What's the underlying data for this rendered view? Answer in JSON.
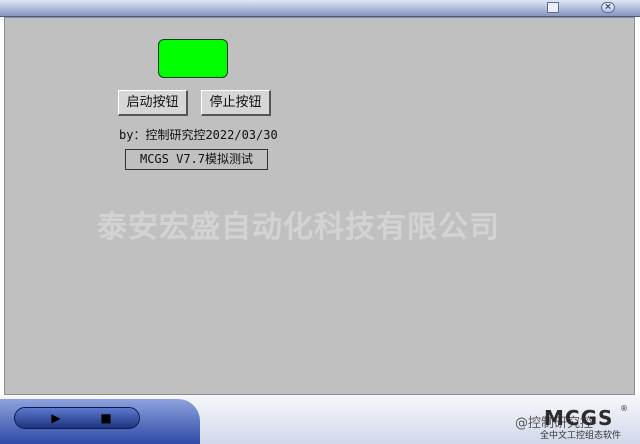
{
  "title_bar": {
    "close_glyph": "×"
  },
  "controls": {
    "start_button": "启动按钮",
    "stop_button": "停止按钮",
    "lamp_color": "#00ff00"
  },
  "info": {
    "author_line": "by：控制研究控2022/03/30",
    "version_label": "MCGS V7.7模拟测试"
  },
  "watermark": "泰安宏盛自动化科技有限公司",
  "player": {
    "play_glyph": "▶",
    "stop_glyph": "■"
  },
  "branding": {
    "logo": "MCGS",
    "registered": "®",
    "tagline": "全中文工控组态软件",
    "social": "@控制研究控"
  }
}
